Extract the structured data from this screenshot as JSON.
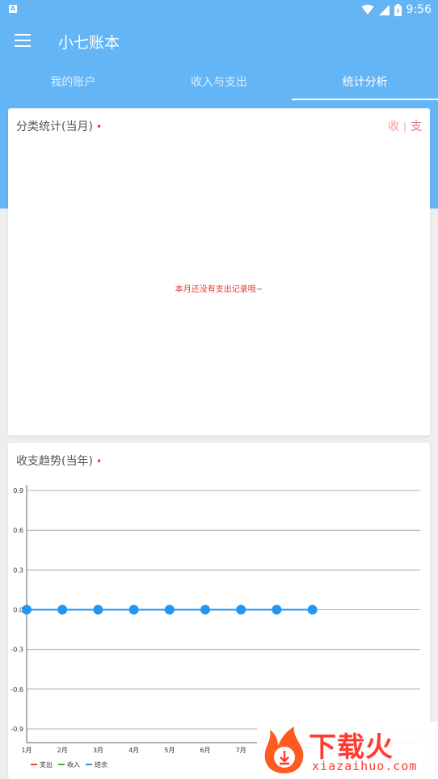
{
  "status": {
    "time": "9:56",
    "app_icon": "A"
  },
  "appbar": {
    "title": "小七账本"
  },
  "tabs": [
    {
      "label": "我的账户",
      "active": false
    },
    {
      "label": "收入与支出",
      "active": false
    },
    {
      "label": "统计分析",
      "active": true
    }
  ],
  "category_card": {
    "title": "分类统计(当月)",
    "dot": "•",
    "toggle_income": "收",
    "toggle_sep": "|",
    "toggle_expense": "支",
    "empty_message": "本月还没有支出记录哦~"
  },
  "trend_card": {
    "title": "收支趋势(当年)",
    "dot": "•"
  },
  "chart_data": {
    "type": "line",
    "categories": [
      "1月",
      "2月",
      "3月",
      "4月",
      "5月",
      "6月",
      "7月"
    ],
    "x_visible_points": 9,
    "series": [
      {
        "name": "支出",
        "color": "#f44336",
        "values": [
          0,
          0,
          0,
          0,
          0,
          0,
          0,
          0,
          0
        ]
      },
      {
        "name": "收入",
        "color": "#4caf50",
        "values": [
          0,
          0,
          0,
          0,
          0,
          0,
          0,
          0,
          0
        ]
      },
      {
        "name": "结余",
        "color": "#2196f3",
        "values": [
          0,
          0,
          0,
          0,
          0,
          0,
          0,
          0,
          0
        ]
      }
    ],
    "y_ticks": [
      "0.9",
      "0.6",
      "0.3",
      "0.0",
      "-0.3",
      "-0.6",
      "-0.9"
    ],
    "ylim": [
      -0.9,
      0.9
    ],
    "grid": true,
    "legend": "bottom-left"
  },
  "watermark": {
    "brand": "下载火",
    "url": "xiazaihuo.com"
  }
}
